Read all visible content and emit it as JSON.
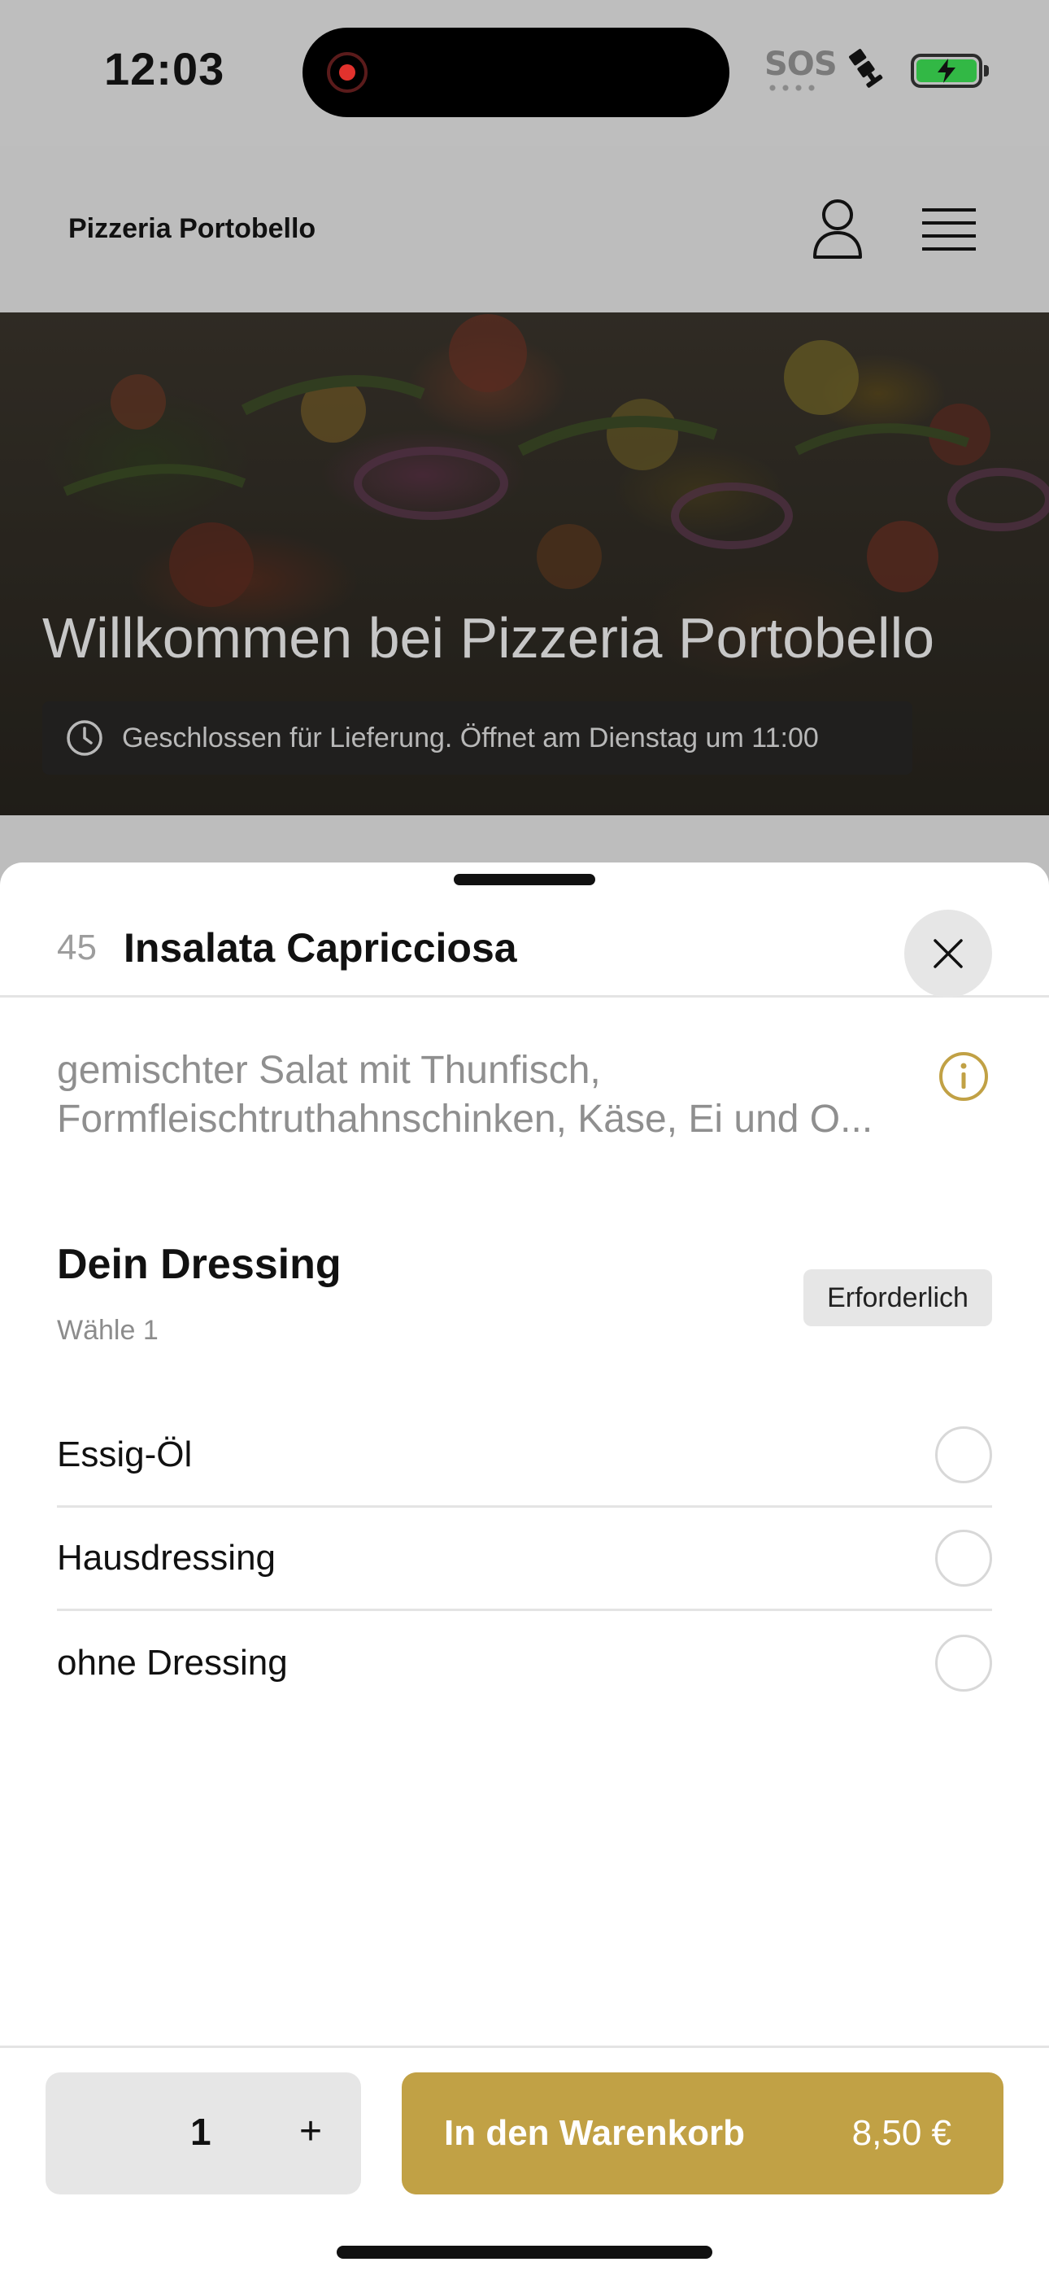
{
  "status_bar": {
    "time": "12:03",
    "sos": "SOS",
    "battery_state": "charging"
  },
  "app_bar": {
    "brand": "Pizzeria Portobello",
    "icons": [
      "user-icon",
      "menu-icon"
    ]
  },
  "hero": {
    "title": "Willkommen bei Pizzeria Portobello",
    "status_text": "Geschlossen für Lieferung. Öffnet am Dienstag um 11:00"
  },
  "sheet": {
    "item_number": "45",
    "item_title": "Insalata Capricciosa",
    "description_line1": "gemischter Salat mit Thunfisch,",
    "description_line2": "Formfleischtruthahnschinken, Käse, Ei und O...",
    "section": {
      "title": "Dein Dressing",
      "subtitle": "Wähle 1",
      "required_label": "Erforderlich",
      "options": [
        {
          "label": "Essig-Öl",
          "selected": false
        },
        {
          "label": "Hausdressing",
          "selected": false
        },
        {
          "label": "ohne Dressing",
          "selected": false
        }
      ]
    },
    "footer": {
      "quantity": "1",
      "plus_label": "+",
      "cart_label": "In den Warenkorb",
      "price": "8,50 €"
    }
  },
  "colors": {
    "accent": "#c1a145",
    "overlay": "#bdbdbd"
  }
}
